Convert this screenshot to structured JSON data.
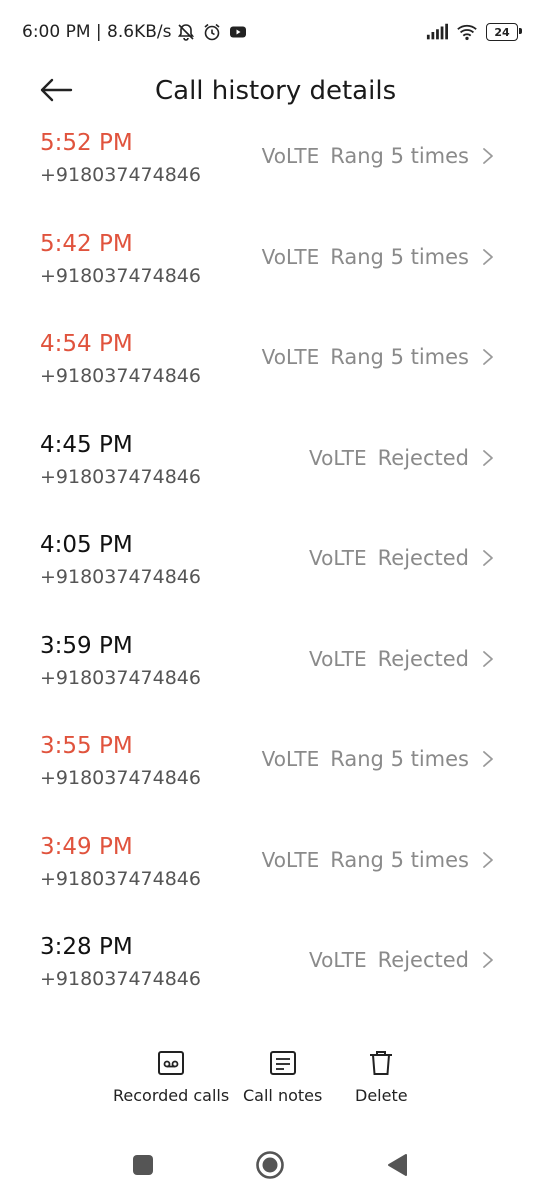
{
  "status_bar": {
    "time_speed": "6:00 PM | 8.6KB/s",
    "battery": "24",
    "icons": [
      "bell-off-icon",
      "alarm-icon",
      "youtube-icon",
      "signal-icon",
      "wifi-icon",
      "battery-icon"
    ]
  },
  "header": {
    "title": "Call history details",
    "back_icon": "arrow-left-icon"
  },
  "colors": {
    "missed": "#e0533d",
    "normal": "#111111",
    "meta": "#8a8a8a"
  },
  "calls": [
    {
      "time": "5:52 PM",
      "number": "+918037474846",
      "network": "VoLTE",
      "status": "Rang 5 times",
      "missed": true
    },
    {
      "time": "5:42 PM",
      "number": "+918037474846",
      "network": "VoLTE",
      "status": "Rang 5 times",
      "missed": true
    },
    {
      "time": "4:54 PM",
      "number": "+918037474846",
      "network": "VoLTE",
      "status": "Rang 5 times",
      "missed": true
    },
    {
      "time": "4:45 PM",
      "number": "+918037474846",
      "network": "VoLTE",
      "status": "Rejected",
      "missed": false
    },
    {
      "time": "4:05 PM",
      "number": "+918037474846",
      "network": "VoLTE",
      "status": "Rejected",
      "missed": false
    },
    {
      "time": "3:59 PM",
      "number": "+918037474846",
      "network": "VoLTE",
      "status": "Rejected",
      "missed": false
    },
    {
      "time": "3:55 PM",
      "number": "+918037474846",
      "network": "VoLTE",
      "status": "Rang 5 times",
      "missed": true
    },
    {
      "time": "3:49 PM",
      "number": "+918037474846",
      "network": "VoLTE",
      "status": "Rang 5 times",
      "missed": true
    },
    {
      "time": "3:28 PM",
      "number": "+918037474846",
      "network": "VoLTE",
      "status": "Rejected",
      "missed": false
    }
  ],
  "actions": {
    "recorded_calls": "Recorded calls",
    "call_notes": "Call notes",
    "delete": "Delete"
  },
  "nav": {
    "icons": [
      "recents-square-icon",
      "home-circle-icon",
      "back-triangle-icon"
    ]
  }
}
